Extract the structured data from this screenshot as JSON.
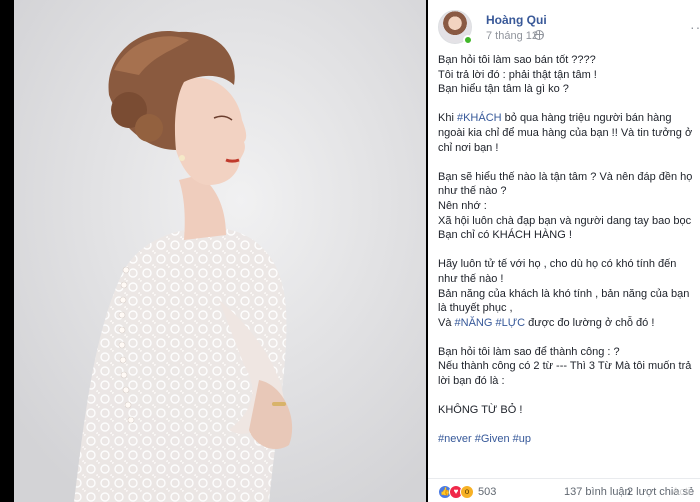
{
  "post": {
    "author": "Hoàng Qui",
    "time": "7 tháng 12 ·",
    "more_icon": "more-options-icon",
    "paragraphs": [
      [
        "Bạn hỏi tôi làm sao bán tốt ????",
        "Tôi trả lời đó : phải thật tận tâm !",
        "Bạn hiểu tận tâm là gì ko ?"
      ],
      [
        "Khi |#KHÁCH| bỏ qua hàng triệu người bán hàng",
        "ngoài kia chỉ để mua hàng của bạn !! Và tin tưởng ở",
        "chỉ nơi bạn !"
      ],
      [
        "Bạn sẽ hiểu thế nào là tận tâm ? Và nên đáp đền họ",
        "như thế nào ?",
        "Nên nhớ :",
        "Xã hội luôn chà đạp bạn và người dang tay bao bọc",
        "Bạn chỉ có KHÁCH HÀNG !"
      ],
      [
        "Hãy luôn tử tế với họ , cho dù họ có khó tính đến",
        "như thế nào !",
        "Bản năng của khách là khó tính , bản năng của bạn",
        "là thuyết phục ,",
        "Và |#NĂNG| |#LỰC| được đo lường ở chỗ đó !"
      ],
      [
        "Bạn hỏi tôi làm sao để thành công : ?",
        "Nếu thành công có 2 từ --- Thì 3 Từ Mà tôi muốn trả",
        "lời bạn đó là :"
      ],
      [
        "KHÔNG TỪ BỎ !"
      ],
      [
        "|#never| |#Given| |#up|"
      ]
    ]
  },
  "footer": {
    "reaction_count": "503",
    "comments": "137 bình luận",
    "shares": "2 lượt chia sẻ",
    "reactions": [
      "like-icon",
      "love-icon",
      "wow-icon"
    ]
  },
  "watermark": "Acti",
  "colors": {
    "link": "#365899",
    "author": "#385898",
    "muted": "#90949c",
    "online": "#42b72a"
  }
}
